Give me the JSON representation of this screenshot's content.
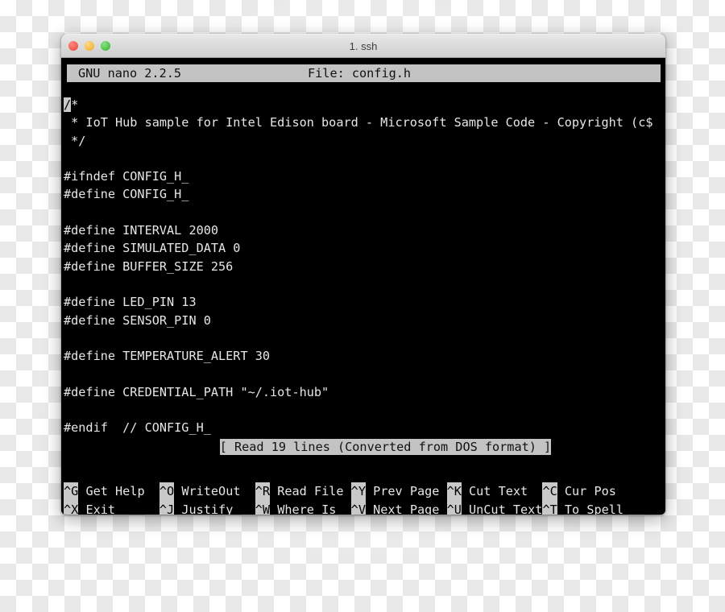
{
  "window": {
    "title": "1. ssh",
    "traffic_lights": [
      {
        "name": "close-button",
        "color": "#f15a52"
      },
      {
        "name": "minimize-button",
        "color": "#f5bb42"
      },
      {
        "name": "zoom-button",
        "color": "#4fc247"
      }
    ]
  },
  "nano": {
    "version_label": "GNU nano 2.2.5",
    "file_label": "File: config.h",
    "status_message": "[ Read 19 lines (Converted from DOS format) ]",
    "cursor_char": "/",
    "lines": [
      {
        "prefix": "",
        "cursor": "/",
        "text": "*"
      },
      {
        "prefix": "",
        "cursor": "",
        "text": " * IoT Hub sample for Intel Edison board - Microsoft Sample Code - Copyright (c$"
      },
      {
        "prefix": "",
        "cursor": "",
        "text": " */"
      },
      {
        "prefix": "",
        "cursor": "",
        "text": ""
      },
      {
        "prefix": "",
        "cursor": "",
        "text": "#ifndef CONFIG_H_"
      },
      {
        "prefix": "",
        "cursor": "",
        "text": "#define CONFIG_H_"
      },
      {
        "prefix": "",
        "cursor": "",
        "text": ""
      },
      {
        "prefix": "",
        "cursor": "",
        "text": "#define INTERVAL 2000"
      },
      {
        "prefix": "",
        "cursor": "",
        "text": "#define SIMULATED_DATA 0"
      },
      {
        "prefix": "",
        "cursor": "",
        "text": "#define BUFFER_SIZE 256"
      },
      {
        "prefix": "",
        "cursor": "",
        "text": ""
      },
      {
        "prefix": "",
        "cursor": "",
        "text": "#define LED_PIN 13"
      },
      {
        "prefix": "",
        "cursor": "",
        "text": "#define SENSOR_PIN 0"
      },
      {
        "prefix": "",
        "cursor": "",
        "text": ""
      },
      {
        "prefix": "",
        "cursor": "",
        "text": "#define TEMPERATURE_ALERT 30"
      },
      {
        "prefix": "",
        "cursor": "",
        "text": ""
      },
      {
        "prefix": "",
        "cursor": "",
        "text": "#define CREDENTIAL_PATH \"~/.iot-hub\""
      },
      {
        "prefix": "",
        "cursor": "",
        "text": ""
      },
      {
        "prefix": "",
        "cursor": "",
        "text": "#endif  // CONFIG_H_"
      }
    ],
    "shortcuts_row1": [
      {
        "key": "^G",
        "label": " Get Help  "
      },
      {
        "key": "^O",
        "label": " WriteOut  "
      },
      {
        "key": "^R",
        "label": " Read File "
      },
      {
        "key": "^Y",
        "label": " Prev Page "
      },
      {
        "key": "^K",
        "label": " Cut Text  "
      },
      {
        "key": "^C",
        "label": " Cur Pos"
      }
    ],
    "shortcuts_row2": [
      {
        "key": "^X",
        "label": " Exit      "
      },
      {
        "key": "^J",
        "label": " Justify   "
      },
      {
        "key": "^W",
        "label": " Where Is  "
      },
      {
        "key": "^V",
        "label": " Next Page "
      },
      {
        "key": "^U",
        "label": " UnCut Text"
      },
      {
        "key": "^T",
        "label": " To Spell"
      }
    ]
  },
  "colors": {
    "terminal_bg": "#000000",
    "terminal_fg": "#e6e6e6",
    "inverted_bg": "#c3c3c3",
    "inverted_fg": "#111111",
    "titlebar_bg": "#dcdcdc"
  }
}
